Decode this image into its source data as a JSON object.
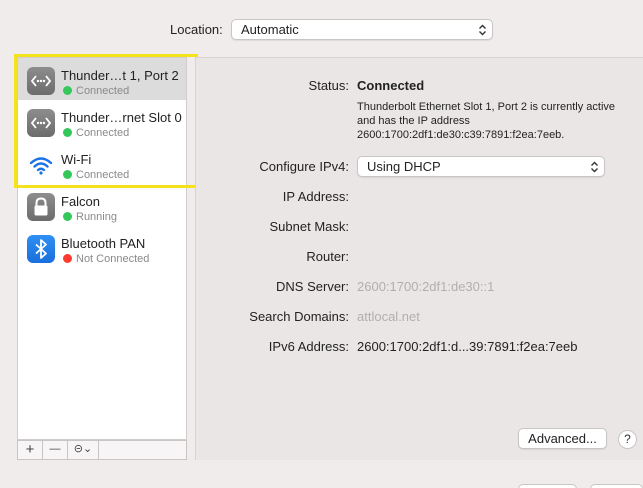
{
  "location": {
    "label": "Location:",
    "value": "Automatic"
  },
  "services": [
    {
      "name": "Thunder…t 1, Port 2",
      "status": "Connected",
      "status_color": "#34c759",
      "icon": "ethernet-icon",
      "selected": true
    },
    {
      "name": "Thunder…rnet Slot 0",
      "status": "Connected",
      "status_color": "#34c759",
      "icon": "ethernet-icon",
      "selected": false
    },
    {
      "name": "Wi-Fi",
      "status": "Connected",
      "status_color": "#34c759",
      "icon": "wifi-icon",
      "selected": false
    },
    {
      "name": "Falcon",
      "status": "Running",
      "status_color": "#34c759",
      "icon": "lock-icon",
      "selected": false
    },
    {
      "name": "Bluetooth PAN",
      "status": "Not Connected",
      "status_color": "#ff3b30",
      "icon": "bluetooth-icon",
      "selected": false
    }
  ],
  "toolbar": {
    "add_label": "+",
    "remove_label": "—",
    "actions_label": "⊝⌄"
  },
  "detail": {
    "status_label": "Status:",
    "status_value": "Connected",
    "status_description": "Thunderbolt Ethernet Slot 1, Port 2 is currently active and has the IP address 2600:1700:2df1:de30:c39:7891:f2ea:7eeb.",
    "configure_ipv4_label": "Configure IPv4:",
    "configure_ipv4_value": "Using DHCP",
    "ip_address_label": "IP Address:",
    "subnet_mask_label": "Subnet Mask:",
    "router_label": "Router:",
    "dns_server_label": "DNS Server:",
    "dns_server_value": "2600:1700:2df1:de30::1",
    "search_domains_label": "Search Domains:",
    "search_domains_value": "attlocal.net",
    "ipv6_address_label": "IPv6 Address:",
    "ipv6_address_value": "2600:1700:2df1:d...39:7891:f2ea:7eeb",
    "advanced_label": "Advanced...",
    "help_label": "?"
  },
  "colors": {
    "highlight": "#f4e31b",
    "selected_row": "#dcdcdc"
  }
}
